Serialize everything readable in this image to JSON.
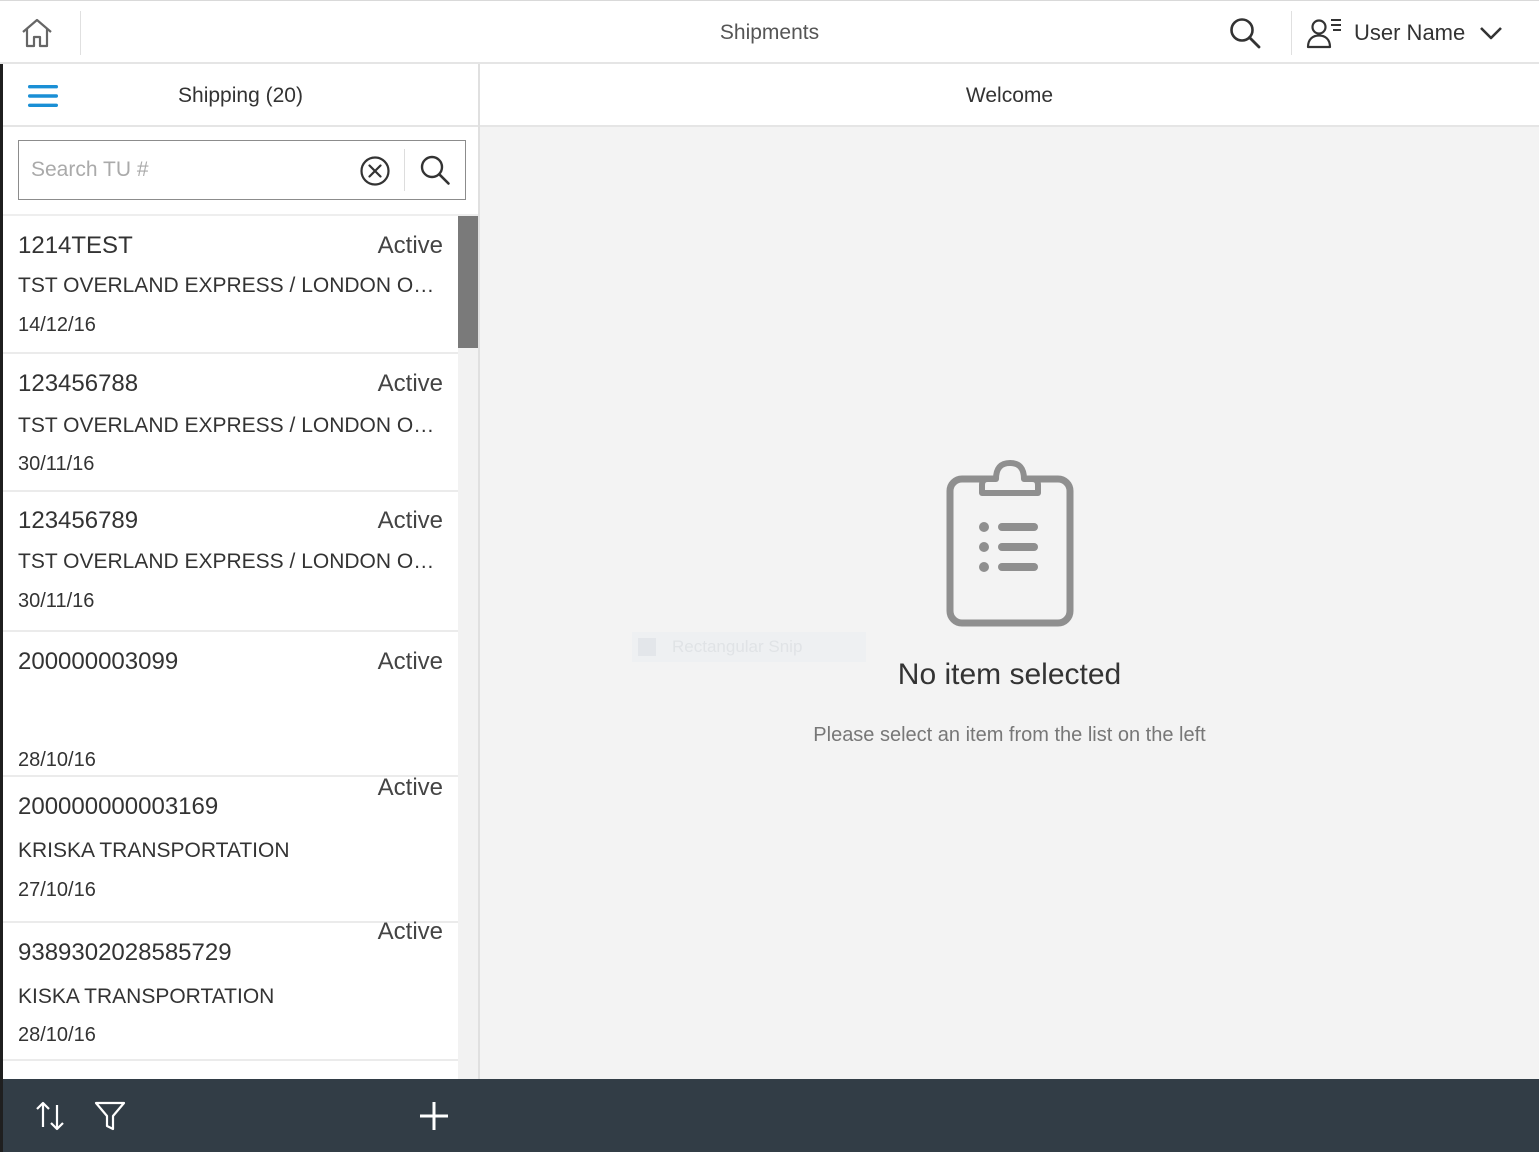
{
  "shell": {
    "title": "Shipments",
    "user_name": "User Name",
    "icons": [
      "home-icon",
      "search-icon",
      "user-icon",
      "chevron-down-icon"
    ]
  },
  "master": {
    "title": "Shipping (20)",
    "search": {
      "placeholder": "Search TU #",
      "value": ""
    },
    "items": [
      {
        "id": "1214TEST",
        "status": "Active",
        "carrier": "TST OVERLAND EXPRESS / LONDON ONTARIO",
        "date": "14/12/16"
      },
      {
        "id": "123456788",
        "status": "Active",
        "carrier": "TST OVERLAND EXPRESS / LONDON ONTARIO",
        "date": "30/11/16"
      },
      {
        "id": "123456789",
        "status": "Active",
        "carrier": "TST OVERLAND EXPRESS / LONDON ONTARIO",
        "date": "30/11/16"
      },
      {
        "id": "200000003099",
        "status": "Active",
        "carrier": "",
        "date": "28/10/16"
      },
      {
        "id": "200000000003169",
        "status": "Active",
        "carrier": "KRISKA TRANSPORTATION",
        "date": "27/10/16"
      },
      {
        "id": "9389302028585729",
        "status": "Active",
        "carrier": "KISKA TRANSPORTATION",
        "date": "28/10/16"
      }
    ],
    "footer_icons": [
      "sort-icon",
      "filter-icon",
      "add-icon"
    ]
  },
  "detail": {
    "title": "Welcome",
    "empty_title": "No item selected",
    "empty_subtitle": "Please select an item from the list on the left",
    "ghost_tooltip": "Rectangular Snip"
  },
  "colors": {
    "accent": "#1a8fd5",
    "footer": "#323d46",
    "detail_bg": "#f3f3f3",
    "icon_gray": "#8f8f8f"
  }
}
